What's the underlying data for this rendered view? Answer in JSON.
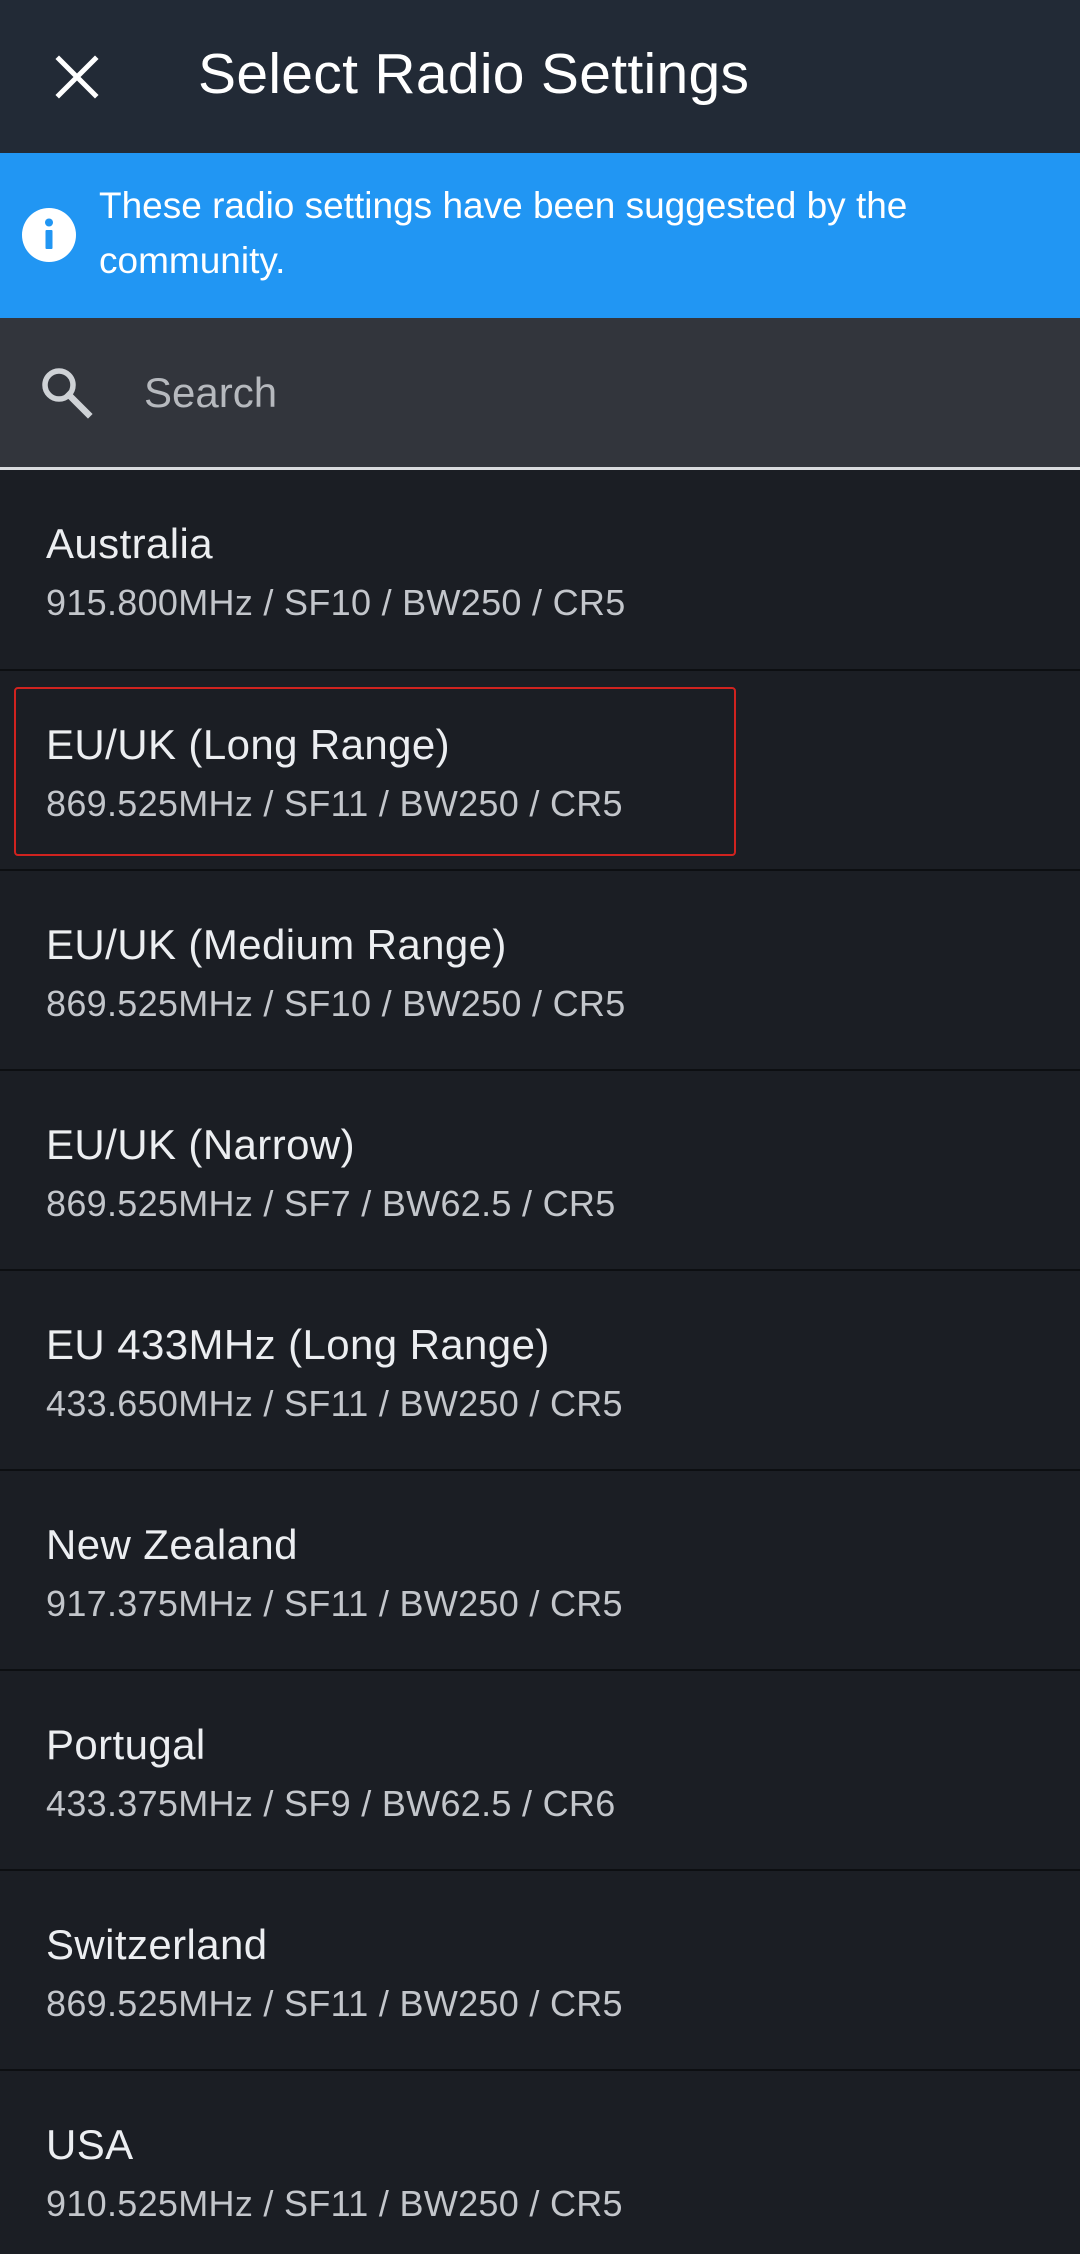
{
  "app_bar": {
    "close_icon": "close-icon",
    "title": "Select Radio Settings"
  },
  "banner": {
    "icon": "info-icon",
    "text": "These radio settings have been suggested by the community.",
    "color": "#2196f3"
  },
  "search": {
    "icon": "search-icon",
    "placeholder": "Search",
    "value": ""
  },
  "presets": [
    {
      "name": "Australia",
      "detail": "915.800MHz / SF10 / BW250 / CR5"
    },
    {
      "name": "EU/UK (Long Range)",
      "detail": "869.525MHz / SF11 / BW250 / CR5"
    },
    {
      "name": "EU/UK (Medium Range)",
      "detail": "869.525MHz / SF10 / BW250 / CR5"
    },
    {
      "name": "EU/UK (Narrow)",
      "detail": "869.525MHz / SF7 / BW62.5 / CR5"
    },
    {
      "name": "EU 433MHz (Long Range)",
      "detail": "433.650MHz / SF11 / BW250 / CR5"
    },
    {
      "name": "New Zealand",
      "detail": "917.375MHz / SF11 / BW250 / CR5"
    },
    {
      "name": "Portugal",
      "detail": "433.375MHz / SF9 / BW62.5 / CR6"
    },
    {
      "name": "Switzerland",
      "detail": "869.525MHz / SF11 / BW250 / CR5"
    },
    {
      "name": "USA",
      "detail": "910.525MHz / SF11 / BW250 / CR5"
    }
  ],
  "colors": {
    "app_bar": "#222a36",
    "background": "#1b1e24",
    "search_bg": "#32353c",
    "highlight": "#d0231f"
  }
}
